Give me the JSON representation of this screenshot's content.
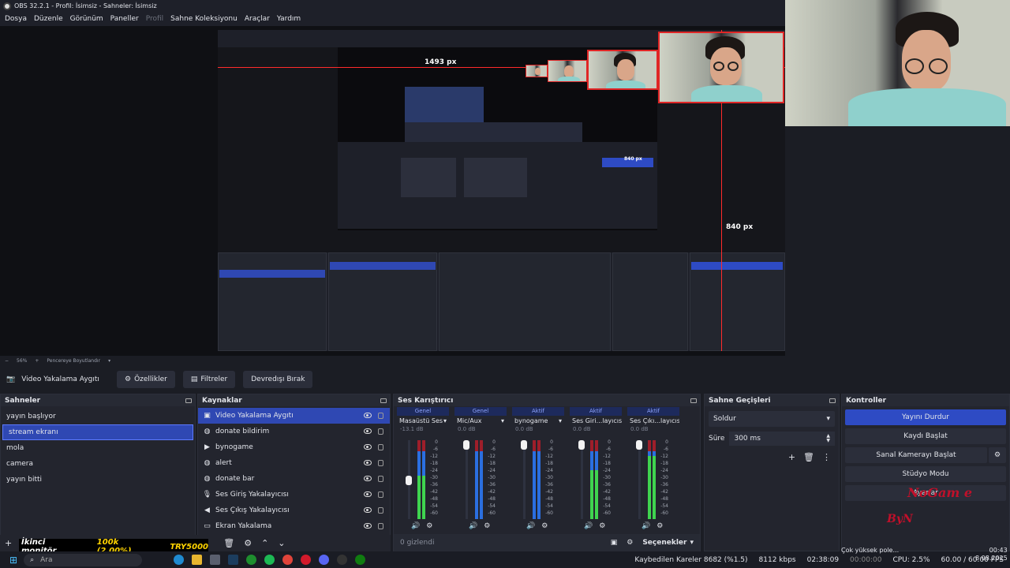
{
  "window": {
    "title": "OBS 32.2.1 - Profil: İsimsiz - Sahneler: İsimsiz"
  },
  "menu": [
    "Dosya",
    "Düzenle",
    "Görünüm",
    "Paneller",
    "Profil",
    "Sahne Koleksiyonu",
    "Araçlar",
    "Yardım"
  ],
  "preview": {
    "width_label": "1493 px",
    "height_label_small": "840 px",
    "height_label": "840 px",
    "zoom": "56%",
    "resize_label": "Pencereye Boyutlandır"
  },
  "toolbar": {
    "source_name": "Video Yakalama Aygıtı",
    "properties": "Özellikler",
    "filters": "Filtreler",
    "deactivate": "Devredışı Bırak"
  },
  "scenes": {
    "title": "Sahneler",
    "items": [
      "yayın başlıyor",
      "stream ekranı",
      "mola",
      "camera",
      "yayın bitti"
    ],
    "selected_index": 1
  },
  "sources": {
    "title": "Kaynaklar",
    "items": [
      {
        "label": "Video Yakalama Aygıtı",
        "icon": "camera-icon"
      },
      {
        "label": "donate bildirim",
        "icon": "globe-icon"
      },
      {
        "label": "bynogame",
        "icon": "play-icon"
      },
      {
        "label": "alert",
        "icon": "globe-icon"
      },
      {
        "label": "donate bar",
        "icon": "globe-icon"
      },
      {
        "label": "Ses Giriş Yakalayıcısı",
        "icon": "microphone-icon"
      },
      {
        "label": "Ses Çıkış Yakalayıcısı",
        "icon": "speaker-icon"
      },
      {
        "label": "Ekran Yakalama",
        "icon": "monitor-icon"
      }
    ]
  },
  "mixer": {
    "title": "Ses Karıştırıcı",
    "strips": [
      {
        "head": "Genel",
        "name": "Masaüstü Ses",
        "db": "-13.1 dB",
        "level": 0.55
      },
      {
        "head": "Genel",
        "name": "Mic/Aux",
        "db": "0.0 dB",
        "level": 0.0
      },
      {
        "head": "Aktif",
        "name": "bynogame",
        "db": "0.0 dB",
        "level": 0.0
      },
      {
        "head": "Aktif",
        "name": "Ses Giri...layıcısı",
        "db": "0.0 dB",
        "level": 0.62
      },
      {
        "head": "Aktif",
        "name": "Ses Çıkı...layıcısı",
        "db": "0.0 dB",
        "level": 0.8
      }
    ],
    "ticks": [
      "0",
      "-6",
      "-12",
      "-18",
      "-24",
      "-30",
      "-36",
      "-42",
      "-48",
      "-54",
      "-60"
    ],
    "hidden_count": "0 gizlendi",
    "options": "Seçenekler"
  },
  "transitions": {
    "title": "Sahne Geçişleri",
    "selected": "Soldur",
    "duration_label": "Süre",
    "duration_value": "300 ms"
  },
  "controls": {
    "title": "Kontroller",
    "stop_stream": "Yayını Durdur",
    "start_record": "Kaydı Başlat",
    "virtual_cam": "Sanal Kamerayı Başlat",
    "studio_mode": "Stüdyo Modu",
    "settings": "Ayarlar"
  },
  "ticker": {
    "left": "İkinci monitör",
    "mid": "100k (2.00%)",
    "right": "TRY5000"
  },
  "logo": {
    "top": "NoGam e",
    "bottom": "ByN"
  },
  "status": {
    "dropped": "Kaybedilen Kareler 8682 (%1.5)",
    "bitrate": "8112 kbps",
    "stream_time": "02:38:09",
    "rec_time": "00:00:00",
    "cpu": "CPU: 2.5%",
    "fps": "60.00 / 60.00 FPS",
    "toast": "Çok yüksek pole...",
    "clock_time": "00:43",
    "clock_date": "8.08.2025"
  },
  "taskbar": {
    "search": "Ara"
  },
  "colors": {
    "accent": "#2f48b3",
    "red": "#ff2b2b",
    "ticker": "#ffd400"
  }
}
